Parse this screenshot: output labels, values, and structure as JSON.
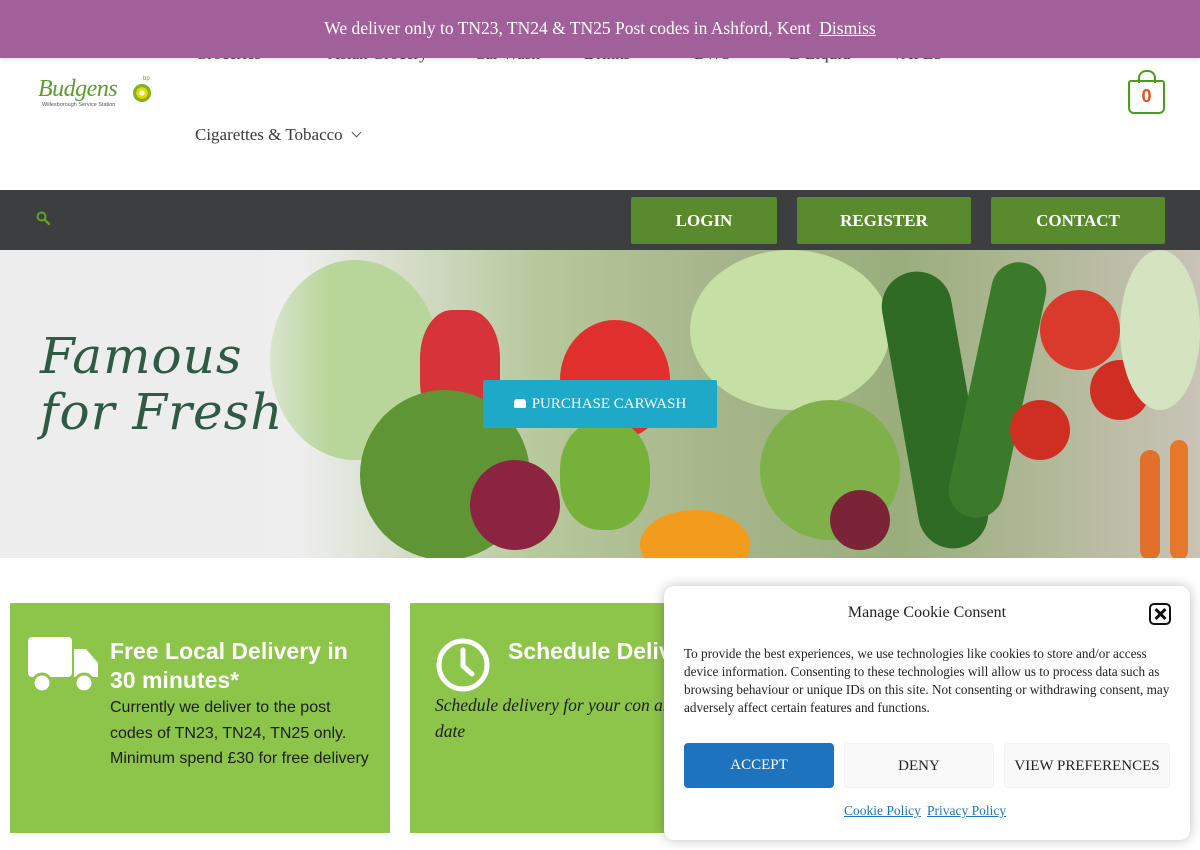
{
  "notice": {
    "text": "We deliver only to TN23, TN24 & TN25 Post codes in Ashford, Kent",
    "dismiss": "Dismiss"
  },
  "logo": {
    "name": "Budgens",
    "subtitle": "Willesborough Service Station",
    "bp": "bp"
  },
  "nav": {
    "items": [
      {
        "label": "Groceries",
        "has_dropdown": true
      },
      {
        "label": "Asian Grocery",
        "has_dropdown": false
      },
      {
        "label": "Car Wash",
        "has_dropdown": false
      },
      {
        "label": "Drinks",
        "has_dropdown": true
      },
      {
        "label": "BWS",
        "has_dropdown": true
      },
      {
        "label": "E-Liquid",
        "has_dropdown": false
      },
      {
        "label": "VAPES",
        "has_dropdown": false
      },
      {
        "label": "Cigarettes & Tobacco",
        "has_dropdown": true
      }
    ]
  },
  "cart": {
    "count": "0"
  },
  "topbar": {
    "login": "LOGIN",
    "register": "REGISTER",
    "contact": "CONTACT"
  },
  "hero": {
    "line1": "Famous",
    "line2": "for Fresh",
    "cta": "PURCHASE CARWASH"
  },
  "features": [
    {
      "icon": "truck-icon",
      "title": "Free Local Delivery in 30 minutes*",
      "text": "Currently we deliver to the post codes of TN23, TN24, TN25 only. Minimum spend £30 for free delivery"
    },
    {
      "icon": "clock-icon",
      "title": "Schedule Deliv",
      "text": "Schedule delivery for your con and date"
    }
  ],
  "cookie": {
    "title": "Manage Cookie Consent",
    "body": "To provide the best experiences, we use technologies like cookies to store and/or access device information. Consenting to these technologies will allow us to process data such as browsing behaviour or unique IDs on this site. Not consenting or withdrawing consent, may adversely affect certain features and functions.",
    "accept": "ACCEPT",
    "deny": "DENY",
    "preferences": "VIEW PREFERENCES",
    "cookie_policy": "Cookie Policy",
    "privacy_policy": "Privacy Policy"
  },
  "colors": {
    "notice_bg": "#a1609a",
    "brand_green": "#5a8a2e",
    "card_green": "#8dc44a",
    "cta_blue": "#1ea9c8",
    "accept_blue": "#1e73be",
    "dark_bar": "#3d3e40"
  }
}
